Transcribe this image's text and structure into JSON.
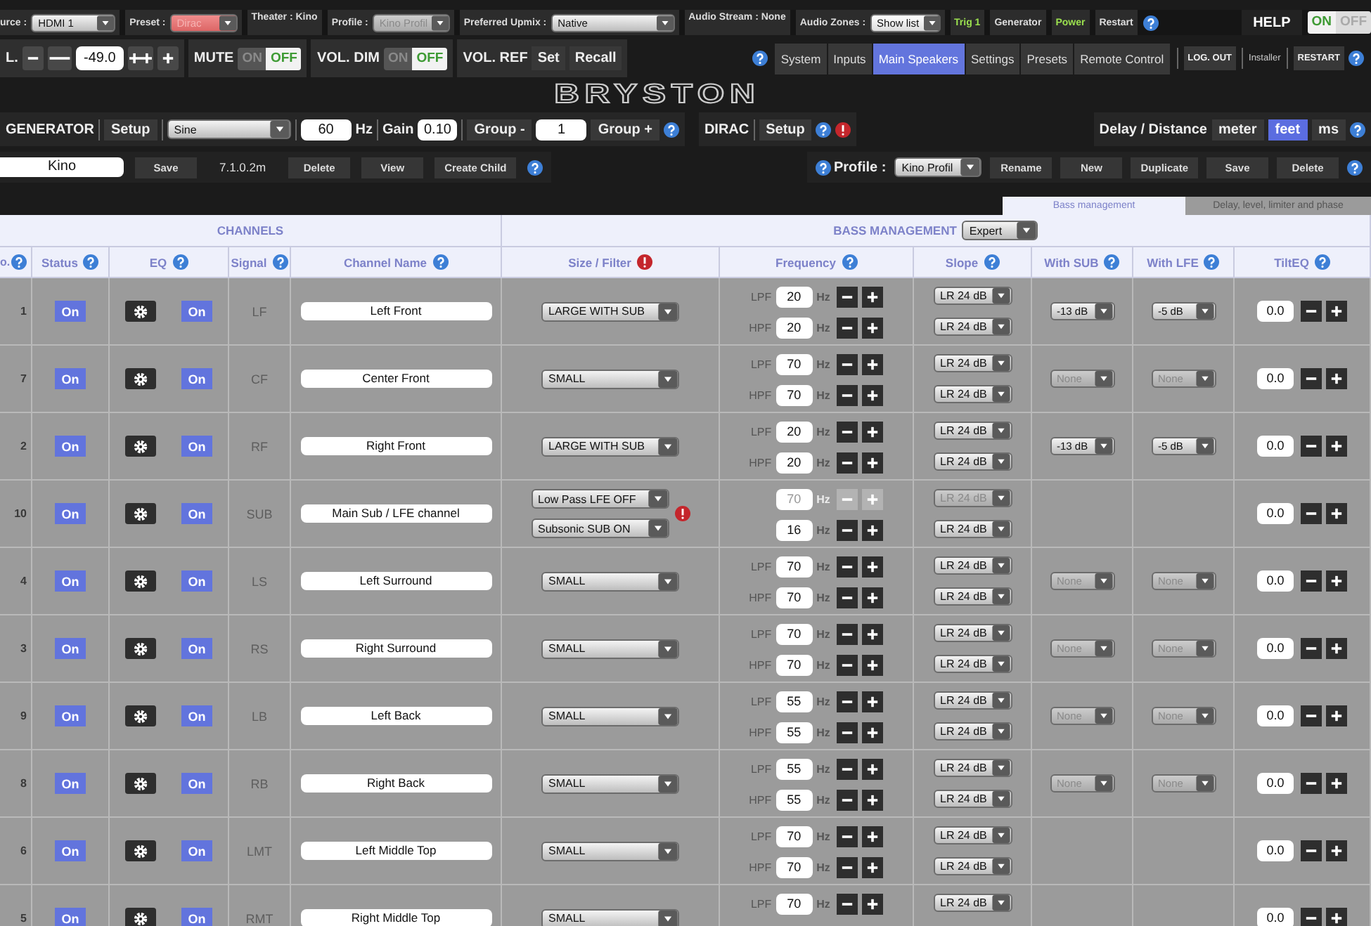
{
  "top_bar": {
    "items": [
      {
        "kind": "select",
        "label": "urce :",
        "value": "HDMI 1",
        "alert": false,
        "disabled": false
      },
      {
        "kind": "select",
        "label": "Preset :",
        "value": "Dirac",
        "alert": true,
        "disabled": false
      },
      {
        "kind": "info",
        "label": "Theater : Kino"
      },
      {
        "kind": "select",
        "label": "Profile :",
        "value": "Kino Profil",
        "alert": false,
        "disabled": true
      },
      {
        "kind": "select",
        "label": "Preferred Upmix :",
        "value": "Native",
        "alert": false,
        "disabled": false
      },
      {
        "kind": "info",
        "label": "Audio Stream : None"
      },
      {
        "kind": "select",
        "label": "Audio Zones :",
        "value": "Show list",
        "alert": false,
        "disabled": false
      },
      {
        "kind": "trigger",
        "label": "Trig 1",
        "active": true
      },
      {
        "kind": "trigger",
        "label": "Generator",
        "active": false
      },
      {
        "kind": "trigger",
        "label": "Power",
        "active": true
      },
      {
        "kind": "trigger",
        "label": "Restart",
        "active": false
      }
    ],
    "help": {
      "label": "HELP",
      "on": "ON",
      "off": "OFF",
      "value": true
    }
  },
  "volume": {
    "label": "L.",
    "value": "-49.0"
  },
  "mute": {
    "label": "MUTE",
    "on": "ON",
    "off": "OFF",
    "value": false
  },
  "vol_dim": {
    "label": "VOL. DIM",
    "on": "ON",
    "off": "OFF",
    "value": false
  },
  "vol_ref": {
    "label": "VOL. REF",
    "buttons": [
      "Set",
      "Recall"
    ]
  },
  "nav": {
    "tabs": [
      {
        "label": "System",
        "selected": false
      },
      {
        "label": "Inputs",
        "selected": false
      },
      {
        "label": "Main Speakers",
        "selected": true
      },
      {
        "label": "Settings",
        "selected": false
      },
      {
        "label": "Presets",
        "selected": false
      },
      {
        "label": "Remote Control",
        "selected": false
      }
    ],
    "logout": "LOG. OUT",
    "user": "Installer",
    "restart": "RESTART"
  },
  "logo": "BRYSTON",
  "generator": {
    "label": "GENERATOR",
    "setup": "Setup",
    "signal": "Sine",
    "frequency": "60",
    "unit": "Hz",
    "gain_label": "Gain",
    "gain": "0.10",
    "group_minus": "Group -",
    "group": "1",
    "group_plus": "Group +"
  },
  "dirac": {
    "label": "DIRAC",
    "setup": "Setup"
  },
  "delay": {
    "label": "Delay / Distance",
    "units": [
      {
        "label": "meter",
        "selected": false
      },
      {
        "label": "feet",
        "selected": true
      },
      {
        "label": "ms",
        "selected": false
      }
    ]
  },
  "preset_bar": {
    "name": "Kino",
    "buttons_1": [
      "Save"
    ],
    "layout": "7.1.0.2m",
    "buttons_2": [
      "Delete",
      "View",
      "Create Child"
    ]
  },
  "profile_bar": {
    "label": "Profile :",
    "value": "Kino Profil",
    "buttons": [
      "Rename",
      "New",
      "Duplicate",
      "Save",
      "Delete"
    ]
  },
  "tabs": [
    {
      "label": "Bass management",
      "selected": true
    },
    {
      "label": "Delay, level, limiter and phase",
      "selected": false
    }
  ],
  "table": {
    "group_channels": "CHANNELS",
    "group_bass": "BASS MANAGEMENT",
    "bass_mode": "Expert",
    "columns": [
      {
        "label": "o.",
        "kind": "help"
      },
      {
        "label": "Status",
        "kind": "help"
      },
      {
        "label": "EQ",
        "kind": "help"
      },
      {
        "label": "Signal",
        "kind": "help"
      },
      {
        "label": "Channel Name",
        "kind": "help"
      },
      {
        "label": "Size / Filter",
        "kind": "warning"
      },
      {
        "label": "Frequency",
        "kind": "help"
      },
      {
        "label": "Slope",
        "kind": "help"
      },
      {
        "label": "With SUB",
        "kind": "help"
      },
      {
        "label": "With LFE",
        "kind": "help"
      },
      {
        "label": "TiltEQ",
        "kind": "help"
      }
    ],
    "rows": [
      {
        "no": "1",
        "status": "On",
        "eq": "On",
        "signal": "LF",
        "name": "Left Front",
        "size": [
          "LARGE WITH SUB"
        ],
        "freq": [
          {
            "label": "LPF",
            "value": "20",
            "unit": "Hz",
            "disabled": false
          },
          {
            "label": "HPF",
            "value": "20",
            "unit": "Hz",
            "disabled": false
          }
        ],
        "slope": [
          {
            "value": "LR 24 dB",
            "disabled": false
          },
          {
            "value": "LR 24 dB",
            "disabled": false
          }
        ],
        "with_sub": {
          "value": "-13 dB",
          "disabled": false
        },
        "with_lfe": {
          "value": "-5 dB",
          "disabled": false
        },
        "tilt": "0.0"
      },
      {
        "no": "7",
        "status": "On",
        "eq": "On",
        "signal": "CF",
        "name": "Center Front",
        "size": [
          "SMALL"
        ],
        "freq": [
          {
            "label": "LPF",
            "value": "70",
            "unit": "Hz",
            "disabled": false
          },
          {
            "label": "HPF",
            "value": "70",
            "unit": "Hz",
            "disabled": false
          }
        ],
        "slope": [
          {
            "value": "LR 24 dB",
            "disabled": false
          },
          {
            "value": "LR 24 dB",
            "disabled": false
          }
        ],
        "with_sub": {
          "value": "None",
          "disabled": true
        },
        "with_lfe": {
          "value": "None",
          "disabled": true
        },
        "tilt": "0.0"
      },
      {
        "no": "2",
        "status": "On",
        "eq": "On",
        "signal": "RF",
        "name": "Right Front",
        "size": [
          "LARGE WITH SUB"
        ],
        "freq": [
          {
            "label": "LPF",
            "value": "20",
            "unit": "Hz",
            "disabled": false
          },
          {
            "label": "HPF",
            "value": "20",
            "unit": "Hz",
            "disabled": false
          }
        ],
        "slope": [
          {
            "value": "LR 24 dB",
            "disabled": false
          },
          {
            "value": "LR 24 dB",
            "disabled": false
          }
        ],
        "with_sub": {
          "value": "-13 dB",
          "disabled": false
        },
        "with_lfe": {
          "value": "-5 dB",
          "disabled": false
        },
        "tilt": "0.0"
      },
      {
        "no": "10",
        "status": "On",
        "eq": "On",
        "signal": "SUB",
        "name": "Main Sub / LFE channel",
        "size": [
          "Low Pass LFE OFF",
          "Subsonic SUB ON"
        ],
        "warn": true,
        "freq": [
          {
            "value": "70",
            "unit": "Hz",
            "disabled": true
          },
          {
            "value": "16",
            "unit": "Hz",
            "disabled": false
          }
        ],
        "slope": [
          {
            "value": "LR 24 dB",
            "disabled": true
          },
          {
            "value": "LR 24 dB",
            "disabled": false
          }
        ],
        "tilt": "0.0"
      },
      {
        "no": "4",
        "status": "On",
        "eq": "On",
        "signal": "LS",
        "name": "Left Surround",
        "size": [
          "SMALL"
        ],
        "freq": [
          {
            "label": "LPF",
            "value": "70",
            "unit": "Hz",
            "disabled": false
          },
          {
            "label": "HPF",
            "value": "70",
            "unit": "Hz",
            "disabled": false
          }
        ],
        "slope": [
          {
            "value": "LR 24 dB",
            "disabled": false
          },
          {
            "value": "LR 24 dB",
            "disabled": false
          }
        ],
        "with_sub": {
          "value": "None",
          "disabled": true
        },
        "with_lfe": {
          "value": "None",
          "disabled": true
        },
        "tilt": "0.0"
      },
      {
        "no": "3",
        "status": "On",
        "eq": "On",
        "signal": "RS",
        "name": "Right Surround",
        "size": [
          "SMALL"
        ],
        "freq": [
          {
            "label": "LPF",
            "value": "70",
            "unit": "Hz",
            "disabled": false
          },
          {
            "label": "HPF",
            "value": "70",
            "unit": "Hz",
            "disabled": false
          }
        ],
        "slope": [
          {
            "value": "LR 24 dB",
            "disabled": false
          },
          {
            "value": "LR 24 dB",
            "disabled": false
          }
        ],
        "with_sub": {
          "value": "None",
          "disabled": true
        },
        "with_lfe": {
          "value": "None",
          "disabled": true
        },
        "tilt": "0.0"
      },
      {
        "no": "9",
        "status": "On",
        "eq": "On",
        "signal": "LB",
        "name": "Left Back",
        "size": [
          "SMALL"
        ],
        "freq": [
          {
            "label": "LPF",
            "value": "55",
            "unit": "Hz",
            "disabled": false
          },
          {
            "label": "HPF",
            "value": "55",
            "unit": "Hz",
            "disabled": false
          }
        ],
        "slope": [
          {
            "value": "LR 24 dB",
            "disabled": false
          },
          {
            "value": "LR 24 dB",
            "disabled": false
          }
        ],
        "with_sub": {
          "value": "None",
          "disabled": true
        },
        "with_lfe": {
          "value": "None",
          "disabled": true
        },
        "tilt": "0.0"
      },
      {
        "no": "8",
        "status": "On",
        "eq": "On",
        "signal": "RB",
        "name": "Right Back",
        "size": [
          "SMALL"
        ],
        "freq": [
          {
            "label": "LPF",
            "value": "55",
            "unit": "Hz",
            "disabled": false
          },
          {
            "label": "HPF",
            "value": "55",
            "unit": "Hz",
            "disabled": false
          }
        ],
        "slope": [
          {
            "value": "LR 24 dB",
            "disabled": false
          },
          {
            "value": "LR 24 dB",
            "disabled": false
          }
        ],
        "with_sub": {
          "value": "None",
          "disabled": true
        },
        "with_lfe": {
          "value": "None",
          "disabled": true
        },
        "tilt": "0.0"
      },
      {
        "no": "6",
        "status": "On",
        "eq": "On",
        "signal": "LMT",
        "name": "Left Middle Top",
        "size": [
          "SMALL"
        ],
        "freq": [
          {
            "label": "LPF",
            "value": "70",
            "unit": "Hz",
            "disabled": false
          },
          {
            "label": "HPF",
            "value": "70",
            "unit": "Hz",
            "disabled": false
          }
        ],
        "slope": [
          {
            "value": "LR 24 dB",
            "disabled": false
          },
          {
            "value": "LR 24 dB",
            "disabled": false
          }
        ],
        "tilt": "0.0"
      },
      {
        "no": "5",
        "status": "On",
        "eq": "On",
        "signal": "RMT",
        "name": "Right Middle Top",
        "size": [
          "SMALL"
        ],
        "freq": [
          {
            "label": "LPF",
            "value": "70",
            "unit": "Hz",
            "disabled": false
          }
        ],
        "slope": [
          {
            "value": "LR 24 dB",
            "disabled": false
          }
        ],
        "tilt": "0.0"
      }
    ]
  }
}
